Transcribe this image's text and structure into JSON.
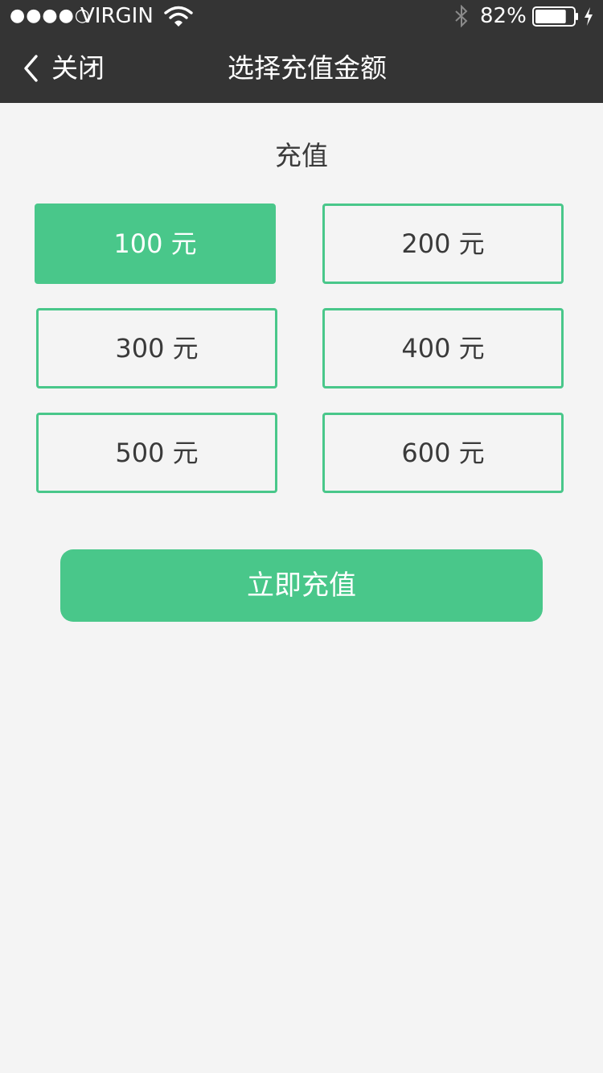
{
  "status_bar": {
    "signal": "●●●●○",
    "carrier": "VIRGIN",
    "wifi_icon": "wifi-icon",
    "bluetooth_icon": "bluetooth-icon",
    "battery_percent": "82%",
    "battery_level": 0.82,
    "charging_icon": "lightning-icon"
  },
  "nav": {
    "back_icon": "chevron-left-icon",
    "back_label": "关闭",
    "title": "选择充值金额"
  },
  "section": {
    "title": "充值"
  },
  "amounts": [
    {
      "label": "100 元",
      "selected": true
    },
    {
      "label": "200 元",
      "selected": false
    },
    {
      "label": "300 元",
      "selected": false
    },
    {
      "label": "400 元",
      "selected": false
    },
    {
      "label": "500 元",
      "selected": false
    },
    {
      "label": "600 元",
      "selected": false
    }
  ],
  "submit": {
    "label": "立即充值"
  },
  "colors": {
    "accent": "#49c78a",
    "header_bg": "#343434",
    "page_bg": "#f4f4f4",
    "text": "#3a3a3a"
  }
}
